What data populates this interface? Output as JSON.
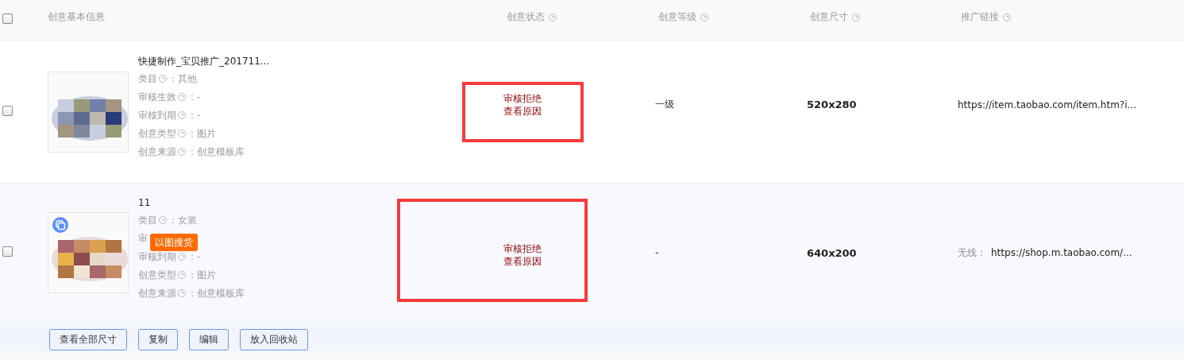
{
  "table": {
    "select_all": {
      "checked": false
    },
    "columns": [
      {
        "label": "创意基本信息",
        "help": false
      },
      {
        "label": "创意状态",
        "help": true
      },
      {
        "label": "创意等级",
        "help": true
      },
      {
        "label": "创意尺寸",
        "help": true
      },
      {
        "label": "推广链接",
        "help": true
      }
    ],
    "rows": [
      {
        "selected": false,
        "title": "快捷制作_宝贝推广_201711...",
        "thumbnail": {
          "kind": "picture",
          "copy_icon": false
        },
        "meta": [
          {
            "label": "类目",
            "value": "：其他"
          },
          {
            "label": "审核生效",
            "value": "：-"
          },
          {
            "label": "审核到期",
            "value": "：-"
          },
          {
            "label": "创意类型",
            "value": "：图片"
          },
          {
            "label": "创意来源",
            "value": "：创意模板库"
          }
        ],
        "status": "审核拒绝",
        "status_link": "查看原因",
        "annotated": true,
        "grade": "一级",
        "size": "520x280",
        "link": "https://item.taobao.com/item.htm?i..."
      },
      {
        "selected": false,
        "title": "11",
        "thumbnail": {
          "kind": "picture",
          "copy_icon": true
        },
        "badge": "以图搜货",
        "meta": [
          {
            "label": "类目",
            "value": "：女装"
          },
          {
            "label": "审"
          },
          {
            "label": "审核到期",
            "value": "：-"
          },
          {
            "label": "创意类型",
            "value": "：图片"
          },
          {
            "label": "创意来源",
            "value": "：创意模板库"
          }
        ],
        "status": "审核拒绝",
        "status_link": "查看原因",
        "annotated": true,
        "grade": "-",
        "size": "640x200",
        "link_prefix": "无线：",
        "link": "https://shop.m.taobao.com/..."
      }
    ],
    "actions": [
      "查看全部尺寸",
      "复制",
      "编辑",
      "放入回收站"
    ]
  }
}
